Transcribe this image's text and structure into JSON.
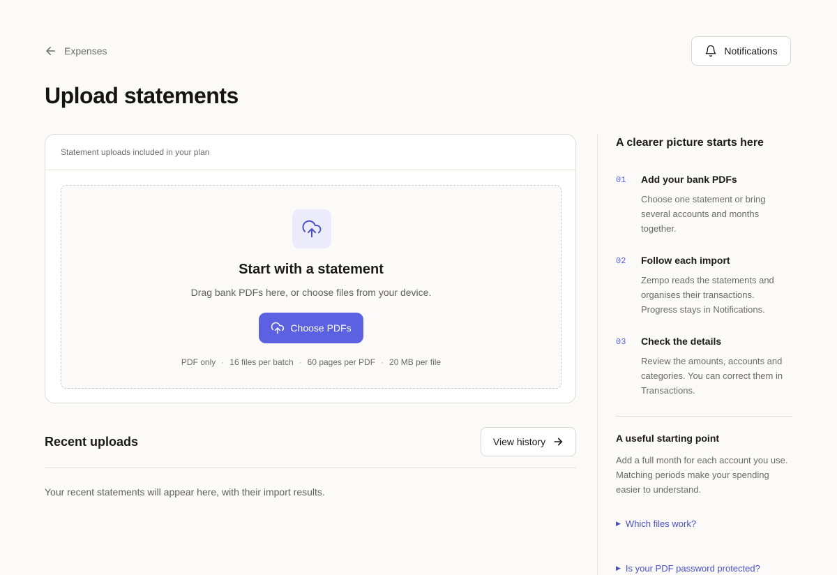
{
  "nav": {
    "back_label": "Expenses"
  },
  "header": {
    "notifications_label": "Notifications"
  },
  "page": {
    "title": "Upload statements"
  },
  "upload_card": {
    "header_text": "Statement uploads included in your plan",
    "title": "Start with a statement",
    "subtitle": "Drag bank PDFs here, or choose files from your device.",
    "button_label": "Choose PDFs",
    "limits": [
      "PDF only",
      "16 files per batch",
      "60 pages per PDF",
      "20 MB per file"
    ],
    "limit_separator": "·"
  },
  "recent": {
    "title": "Recent uploads",
    "history_button": "View history",
    "empty_text": "Your recent statements will appear here, with their import results."
  },
  "sidebar": {
    "title": "A clearer picture starts here",
    "steps": [
      {
        "num": "01",
        "title": "Add your bank PDFs",
        "desc": "Choose one statement or bring several accounts and months together."
      },
      {
        "num": "02",
        "title": "Follow each import",
        "desc": "Zempo reads the statements and organises their transactions. Progress stays in Notifications."
      },
      {
        "num": "03",
        "title": "Check the details",
        "desc": "Review the amounts, accounts and categories. You can correct them in Transactions."
      }
    ],
    "tip_title": "A useful starting point",
    "tip_desc": "Add a full month for each account you use. Matching periods make your spending easier to understand.",
    "faqs": [
      {
        "label": "Which files work?"
      },
      {
        "label": "Is your PDF password protected?"
      }
    ]
  },
  "colors": {
    "accent": "#5b61e0",
    "accent_soft": "#ecebfb",
    "background": "#fbfaf8"
  },
  "icons": [
    "arrow-left-icon",
    "bell-icon",
    "cloud-upload-icon",
    "arrow-right-icon",
    "triangle-right-icon"
  ]
}
